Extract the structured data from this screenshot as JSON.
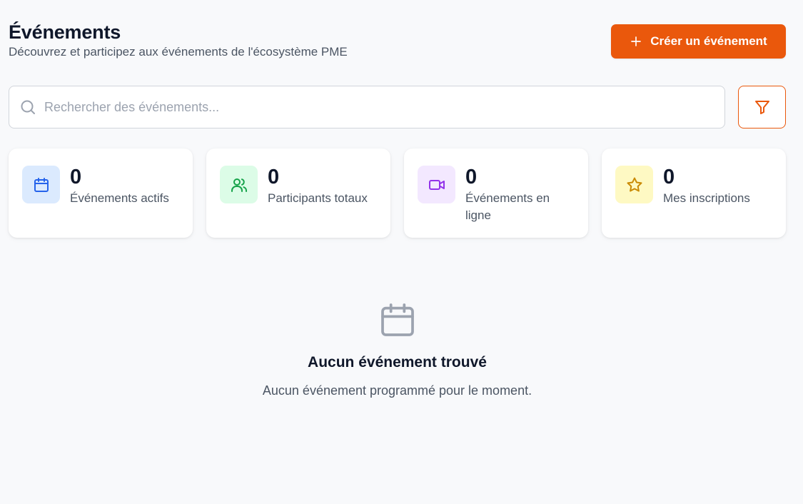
{
  "header": {
    "title": "Événements",
    "subtitle": "Découvrez et participez aux événements de l'écosystème PME",
    "create_button_label": "Créer un événement",
    "create_button_icon": "plus-icon"
  },
  "search": {
    "placeholder": "Rechercher des événements...",
    "value": "",
    "icon": "search-icon",
    "filter_icon": "filter-icon"
  },
  "stats": [
    {
      "value": "0",
      "label": "Événements actifs",
      "icon": "calendar-icon",
      "icon_color": "#2563eb",
      "bg_color": "#dbeafe"
    },
    {
      "value": "0",
      "label": "Participants totaux",
      "icon": "users-icon",
      "icon_color": "#16a34a",
      "bg_color": "#dcfce7"
    },
    {
      "value": "0",
      "label": "Événements en ligne",
      "icon": "video-icon",
      "icon_color": "#9333ea",
      "bg_color": "#f3e8ff"
    },
    {
      "value": "0",
      "label": "Mes inscriptions",
      "icon": "star-icon",
      "icon_color": "#ca8a04",
      "bg_color": "#fef9c3"
    }
  ],
  "empty_state": {
    "icon": "calendar-icon",
    "title": "Aucun événement trouvé",
    "description": "Aucun événement programmé pour le moment."
  },
  "colors": {
    "accent": "#ea580c",
    "background": "#f8f9fb",
    "text_primary": "#0f172a",
    "text_secondary": "#4b5563",
    "muted_icon": "#9ca3af"
  }
}
